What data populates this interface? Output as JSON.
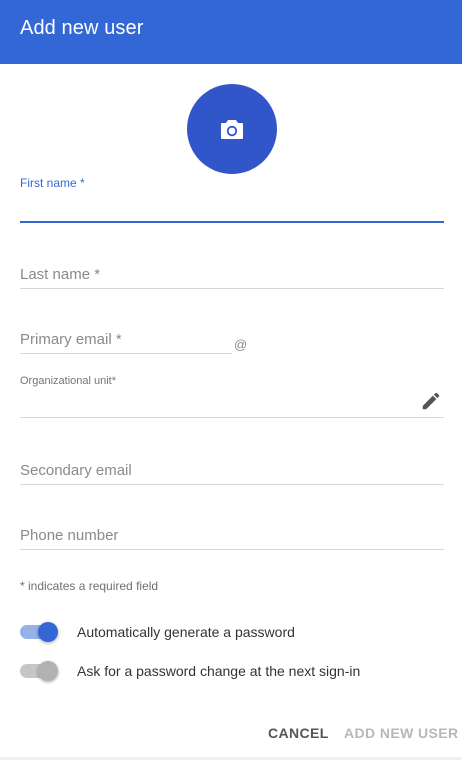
{
  "dialog": {
    "title": "Add new user",
    "accent_color": "#3367d6"
  },
  "avatar": {
    "icon": "camera-icon"
  },
  "form": {
    "first_name": {
      "label": "First name *",
      "value": ""
    },
    "last_name": {
      "placeholder": "Last name *",
      "value": ""
    },
    "primary_email": {
      "placeholder": "Primary email *",
      "value": "",
      "domain_separator": "@"
    },
    "org_unit": {
      "label": "Organizational unit*",
      "value": "",
      "edit_icon": "pencil-icon"
    },
    "secondary_email": {
      "placeholder": "Secondary email",
      "value": ""
    },
    "phone_number": {
      "placeholder": "Phone number",
      "value": ""
    }
  },
  "required_note": "* indicates a required field",
  "toggles": [
    {
      "label": "Automatically generate a password",
      "on": true
    },
    {
      "label": "Ask for a password change at the next sign-in",
      "on": false
    }
  ],
  "actions": {
    "cancel_label": "CANCEL",
    "add_label": "ADD NEW USER",
    "add_enabled": false
  }
}
